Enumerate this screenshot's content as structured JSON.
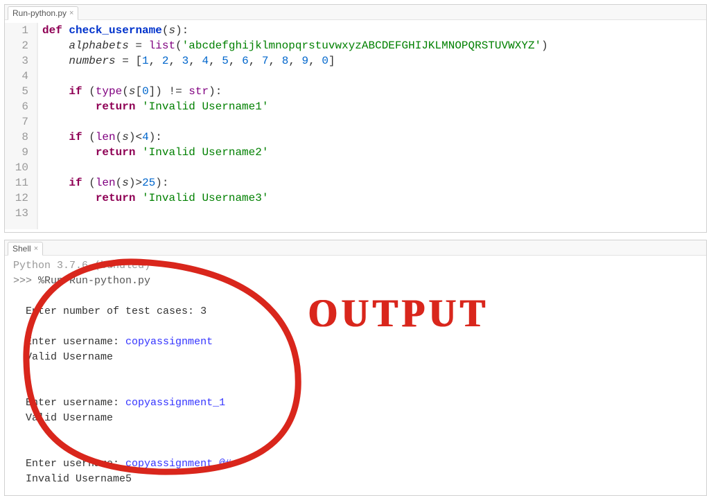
{
  "editor": {
    "tab": "Run-python.py",
    "lines": [
      "1",
      "2",
      "3",
      "4",
      "5",
      "6",
      "7",
      "8",
      "9",
      "10",
      "11",
      "12",
      "13"
    ],
    "c": {
      "def": "def",
      "fname": "check_username",
      "param": "s",
      "alphabets_var": "alphabets",
      "eq": " = ",
      "list": "list",
      "alpha_str": "'abcdefghijklmnopqrstuvwxyzABCDEFGHIJKLMNOPQRSTUVWXYZ'",
      "numbers_var": "numbers",
      "lbr": "[",
      "rbr": "]",
      "n1": "1",
      "n2": "2",
      "n3": "3",
      "n4": "4",
      "n5": "5",
      "n6": "6",
      "n7": "7",
      "n8": "8",
      "n9": "9",
      "n0": "0",
      "comma": ", ",
      "if": "if",
      "type": "type",
      "zero": "0",
      "neq": " != ",
      "str": "str",
      "return": "return",
      "inval1": "'Invalid Username1'",
      "len": "len",
      "lt4": "<",
      "four": "4",
      "gt": ">",
      "twentyfive": "25",
      "inval2": "'Invalid Username2'",
      "inval3": "'Invalid Username3'",
      "lp": "(",
      "rp": ")",
      "colon": ":"
    }
  },
  "shell": {
    "tab": "Shell",
    "version": "Python 3.7.6 (bundled)",
    "prompt": ">>>",
    "runcmd": "%Run Run-python.py",
    "l_cases_label": "Enter number of test cases: ",
    "l_cases_val": "3",
    "l_user_label": "Enter username: ",
    "u1": "copyassignment",
    "r1": "Valid Username",
    "u2": "copyassignment_1",
    "r2": "Valid Username",
    "u3": "copyassignment_@#",
    "r3": "Invalid Username5"
  },
  "annot": {
    "output": "OUTPUT"
  }
}
